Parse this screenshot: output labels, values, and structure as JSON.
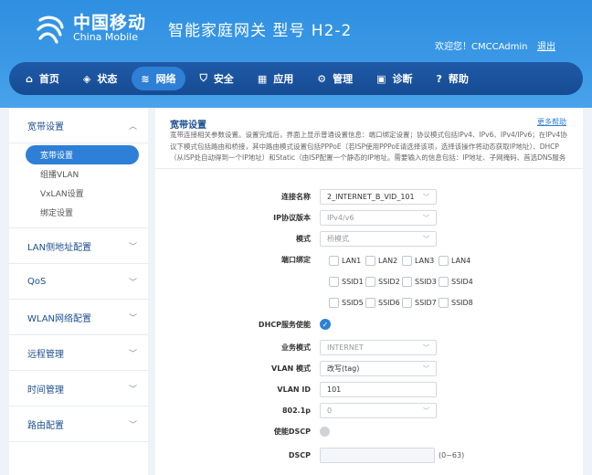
{
  "header": {
    "brand_cn": "中国移动",
    "brand_en": "China Mobile",
    "product": "智能家庭网关  型号 H2-2",
    "welcome": "欢迎您！CMCCAdmin",
    "logout": "退出"
  },
  "nav": {
    "items": [
      {
        "label": "首页",
        "icon": "home-icon"
      },
      {
        "label": "状态",
        "icon": "layers-icon"
      },
      {
        "label": "网络",
        "icon": "wifi-icon"
      },
      {
        "label": "安全",
        "icon": "shield-icon"
      },
      {
        "label": "应用",
        "icon": "grid-icon"
      },
      {
        "label": "管理",
        "icon": "gear-icon"
      },
      {
        "label": "诊断",
        "icon": "toolbox-icon"
      },
      {
        "label": "帮助",
        "icon": "help-icon"
      }
    ],
    "active": "网络"
  },
  "sidebar": {
    "broadband": "宽带设置",
    "broadband_subs": [
      "宽带设置",
      "组播VLAN",
      "VxLAN设置",
      "绑定设置"
    ],
    "groups": [
      "LAN侧地址配置",
      "QoS",
      "WLAN网络配置",
      "远程管理",
      "时间管理",
      "路由配置"
    ]
  },
  "content": {
    "title": "宽带设置",
    "more_help": "更多帮助",
    "description": "宽带连接相关参数设置。设置完成后，界面上显示普通设置信息：端口绑定设置；协议模式包括IPv4、IPv6、IPv4/IPv6；在IPv4协议下模式包括路由和桥接，其中路由模式设置包括PPPoE（若ISP使用PPPoE请选择该项，选择该操作将动态获取IP地址）、DHCP（从ISP处自动得到一个IP地址）和Static（由ISP配置一个静态的IP地址。需要输入的信息包括：IP地址、子网掩码、首选DNS服务器",
    "form": {
      "connection_name_label": "连接名称",
      "connection_name": "2_INTERNET_B_VID_101",
      "ip_protocol_label": "IP协议版本",
      "ip_protocol": "IPv4/v6",
      "mode_label": "模式",
      "mode": "桥模式",
      "port_binding_label": "端口绑定",
      "ports_row1": [
        "LAN1",
        "LAN2",
        "LAN3",
        "LAN4"
      ],
      "ports_row2": [
        "SSID1",
        "SSID2",
        "SSID3",
        "SSID4"
      ],
      "ports_row3": [
        "SSID5",
        "SSID6",
        "SSID7",
        "SSID8"
      ],
      "dhcp_label": "DHCP服务使能",
      "service_mode_label": "业务模式",
      "service_mode": "INTERNET",
      "vlan_mode_label": "VLAN 模式",
      "vlan_mode": "改写(tag)",
      "vlan_id_label": "VLAN ID",
      "vlan_id": "101",
      "p8021_label": "802.1p",
      "p8021": "0",
      "enable_dscp_label": "使能DSCP",
      "dscp_label": "DSCP",
      "dscp_value": "",
      "dscp_hint": "(0~63)"
    }
  }
}
